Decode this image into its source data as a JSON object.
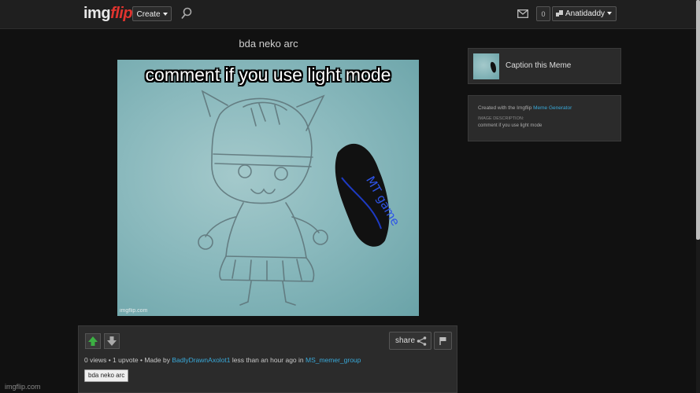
{
  "header": {
    "logo_main": "img",
    "logo_accent": "flip",
    "create_label": "Create",
    "notification_count": "0",
    "username": "Anatidaddy"
  },
  "meme": {
    "title": "bda neko arc",
    "caption": "comment if you use light mode",
    "watermark": "imgflip.com",
    "handwritten_text": "MT game"
  },
  "panel": {
    "share_label": "share",
    "stats": "0 views • 1 upvote • Made by",
    "author": "BadlyDrawnAxolot1",
    "time_text": "less than an hour ago in",
    "stream": "MS_memer_group",
    "tag": "bda neko arc"
  },
  "sidebar": {
    "caption_label": "Caption this Meme",
    "created_prefix": "Created with the Imgflip",
    "generator_link": "Meme Generator",
    "description_heading": "IMAGE DESCRIPTION:",
    "description": "comment if you use light mode"
  },
  "footer": {
    "watermark": "imgflip.com"
  },
  "colors": {
    "link": "#39a9d9",
    "logo_accent": "#e0342f",
    "upvote": "#3cb043",
    "background": "#111111"
  }
}
